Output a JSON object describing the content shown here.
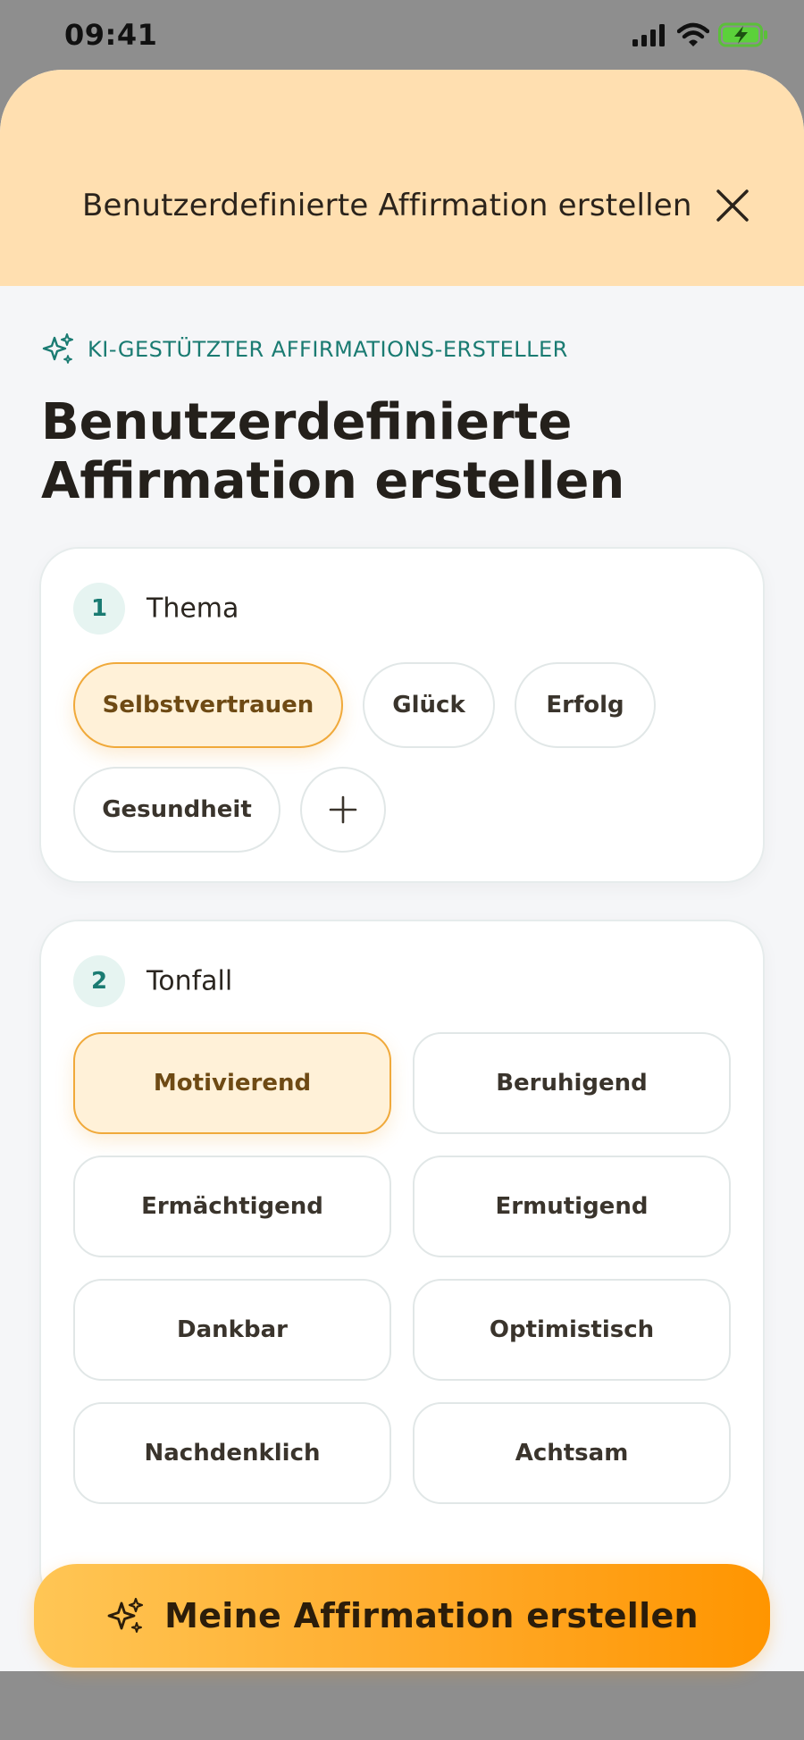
{
  "status_bar": {
    "time": "09:41"
  },
  "header": {
    "title": "Benutzerdefinierte Affirmation erstellen"
  },
  "section_label": "KI-GESTÜTZTER AFFIRMATIONS-ERSTELLER",
  "main_title_line1": "Benutzerdefinierte",
  "main_title_line2": "Affirmation erstellen",
  "theme": {
    "number": "1",
    "label": "Thema",
    "options": [
      "Selbstvertrauen",
      "Glück",
      "Erfolg",
      "Gesundheit"
    ],
    "selected": "Selbstvertrauen",
    "add_icon": "plus-icon"
  },
  "tone": {
    "number": "2",
    "label": "Tonfall",
    "options": [
      "Motivierend",
      "Beruhigend",
      "Ermächtigend",
      "Ermutigend",
      "Dankbar",
      "Optimistisch",
      "Nachdenklich",
      "Achtsam"
    ],
    "selected": "Motivierend"
  },
  "cta": {
    "label": "Meine Affirmation erstellen",
    "icon": "sparkle-icon"
  },
  "colors": {
    "accent_teal": "#1a7b72",
    "header_bg": "#ffdfb0",
    "selected_border": "#f0a93a",
    "cta_start": "#ffc655",
    "cta_end": "#ff9500"
  }
}
